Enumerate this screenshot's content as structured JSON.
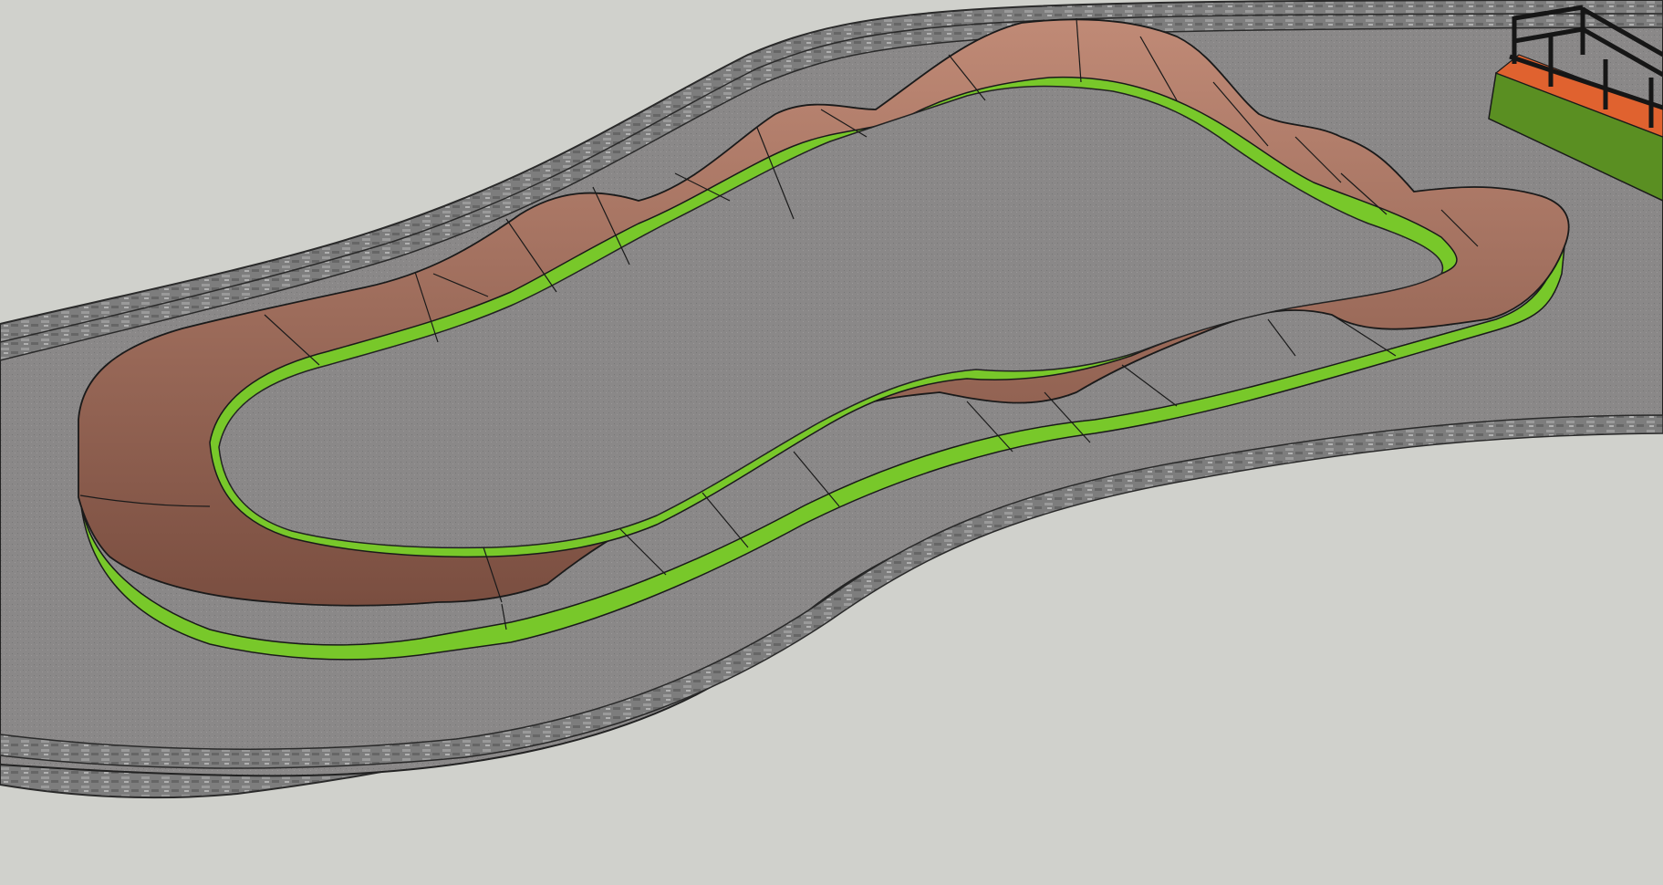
{
  "scene": {
    "subject": "pump-track",
    "colors": {
      "background": "#d0d1cc",
      "ground": "#8a8888",
      "curb": "#7e7e7e",
      "berm_light": "#b98571",
      "berm_dark": "#7e5244",
      "side_wall": "#78c82a",
      "side_wall_dark": "#5c9e1e",
      "edge_line": "#1a1a1a",
      "platform_green": "#5a8f22",
      "platform_top": "#e0622f",
      "railing": "#161616"
    }
  }
}
